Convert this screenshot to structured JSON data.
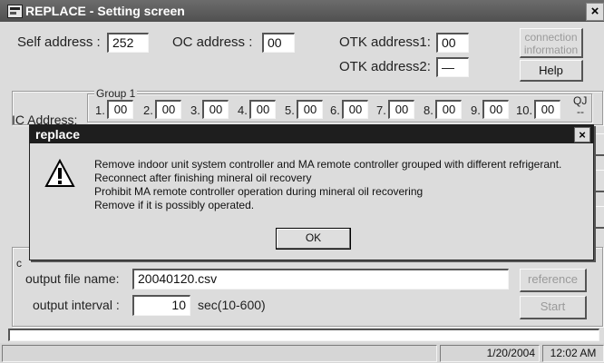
{
  "window": {
    "title": "REPLACE - Setting screen",
    "close": "×"
  },
  "addresses": {
    "self_label": "Self address :",
    "self_value": "252",
    "oc_label": "OC address :",
    "oc_value": "00",
    "otk1_label": "OTK address1:",
    "otk1_value": "00",
    "otk2_label": "OTK address2:",
    "otk2_value": "—"
  },
  "buttons": {
    "connection_line1": "connection",
    "connection_line2": "information",
    "help": "Help",
    "reference": "reference",
    "start": "Start"
  },
  "ic": {
    "label": "IC Address:",
    "group_label": "Group 1",
    "right_hint_1": "QJ",
    "right_hint_2": "--",
    "slots": [
      {
        "no": "1.",
        "value": "00"
      },
      {
        "no": "2.",
        "value": "00"
      },
      {
        "no": "3.",
        "value": "00"
      },
      {
        "no": "4.",
        "value": "00"
      },
      {
        "no": "5.",
        "value": "00"
      },
      {
        "no": "6.",
        "value": "00"
      },
      {
        "no": "7.",
        "value": "00"
      },
      {
        "no": "8.",
        "value": "00"
      },
      {
        "no": "9.",
        "value": "00"
      },
      {
        "no": "10.",
        "value": "00"
      }
    ]
  },
  "output": {
    "group_partial": "c",
    "file_label": "output file name:",
    "file_value": "20040120.csv",
    "interval_label": "output interval :",
    "interval_value": "10",
    "interval_unit": "sec(10-600)"
  },
  "dialog": {
    "title": "replace",
    "close": "×",
    "icon": "warning-icon",
    "lines": [
      "Remove indoor unit system controller and MA remote controller grouped with different refrigerant.",
      "Reconnect after finishing mineral oil recovery",
      "Prohibit MA remote controller operation during mineral oil recovering",
      "Remove if it is possibly operated."
    ],
    "ok": "OK"
  },
  "statusbar": {
    "date": "1/20/2004",
    "time": "12:02 AM"
  }
}
